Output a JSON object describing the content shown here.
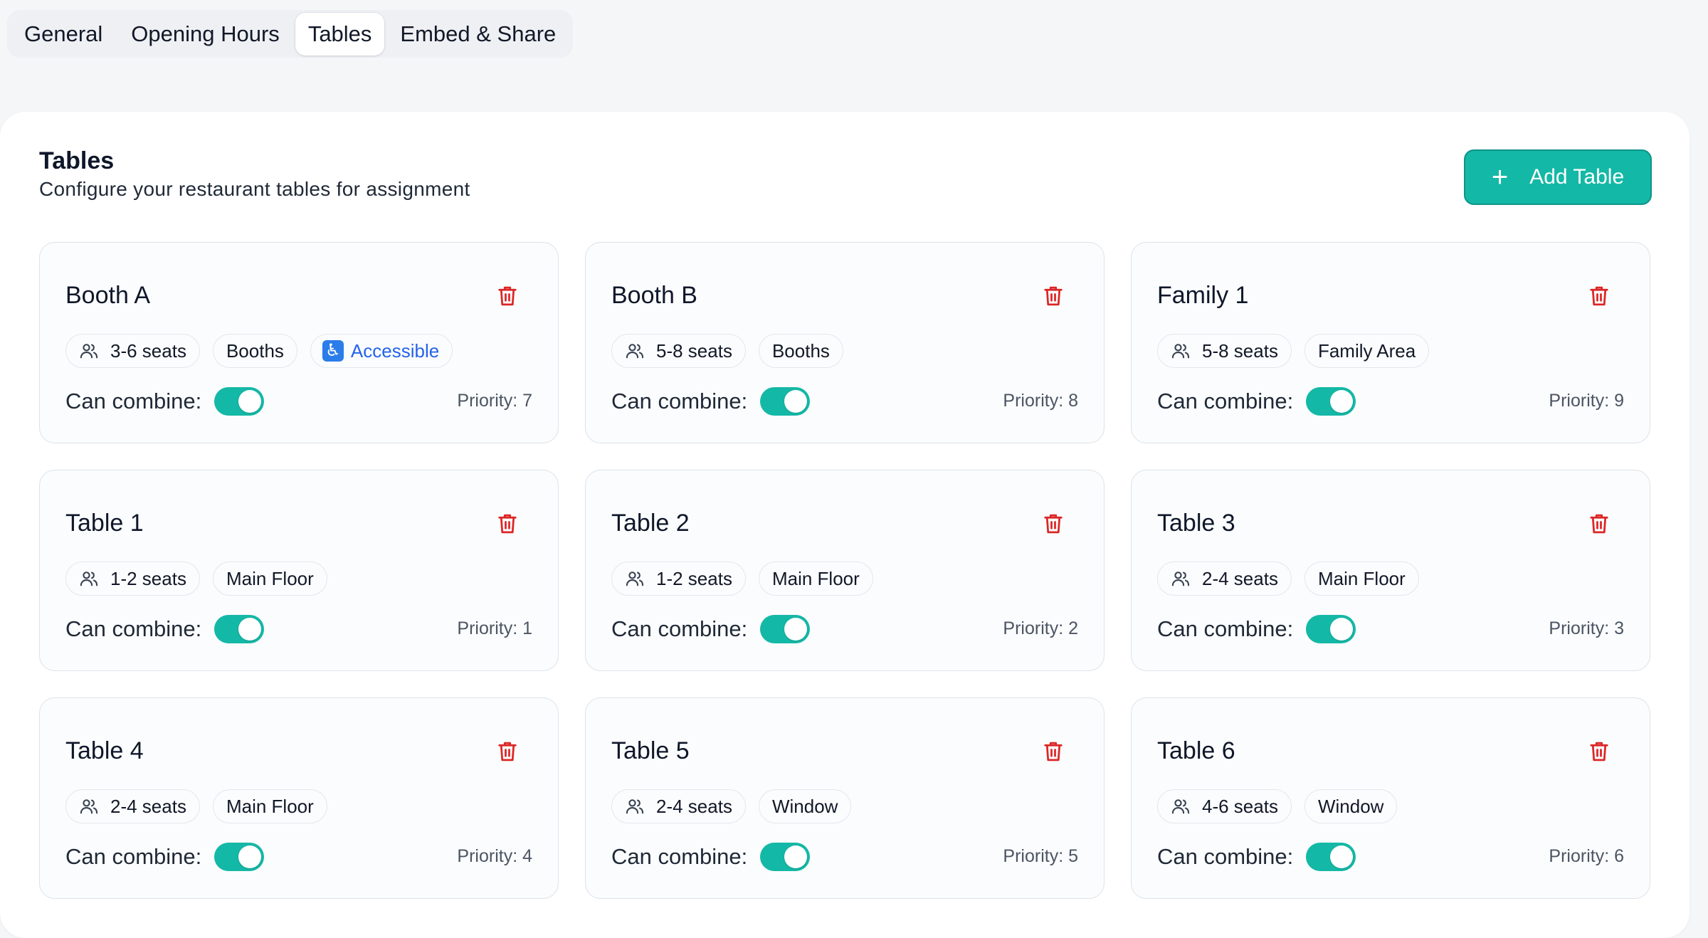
{
  "tabs": [
    {
      "label": "General",
      "active": false
    },
    {
      "label": "Opening Hours",
      "active": false
    },
    {
      "label": "Tables",
      "active": true
    },
    {
      "label": "Embed & Share",
      "active": false
    }
  ],
  "panel": {
    "title": "Tables",
    "subtitle": "Configure your restaurant tables for assignment",
    "add_button": {
      "icon": "plus-icon",
      "label": "Add Table"
    }
  },
  "combine_label": "Can combine:",
  "colors": {
    "accent": "#14b8a6",
    "danger": "#dc2626",
    "accessible": "#2563eb"
  },
  "tables": [
    {
      "name": "Booth A",
      "seats": "3-6 seats",
      "area": "Booths",
      "accessible": "Accessible",
      "combine": true,
      "priority": "Priority: 7"
    },
    {
      "name": "Booth B",
      "seats": "5-8 seats",
      "area": "Booths",
      "combine": true,
      "priority": "Priority: 8"
    },
    {
      "name": "Family 1",
      "seats": "5-8 seats",
      "area": "Family Area",
      "combine": true,
      "priority": "Priority: 9"
    },
    {
      "name": "Table 1",
      "seats": "1-2 seats",
      "area": "Main Floor",
      "combine": true,
      "priority": "Priority: 1"
    },
    {
      "name": "Table 2",
      "seats": "1-2 seats",
      "area": "Main Floor",
      "combine": true,
      "priority": "Priority: 2"
    },
    {
      "name": "Table 3",
      "seats": "2-4 seats",
      "area": "Main Floor",
      "combine": true,
      "priority": "Priority: 3"
    },
    {
      "name": "Table 4",
      "seats": "2-4 seats",
      "area": "Main Floor",
      "combine": true,
      "priority": "Priority: 4"
    },
    {
      "name": "Table 5",
      "seats": "2-4 seats",
      "area": "Window",
      "combine": true,
      "priority": "Priority: 5"
    },
    {
      "name": "Table 6",
      "seats": "4-6 seats",
      "area": "Window",
      "combine": true,
      "priority": "Priority: 6"
    }
  ]
}
